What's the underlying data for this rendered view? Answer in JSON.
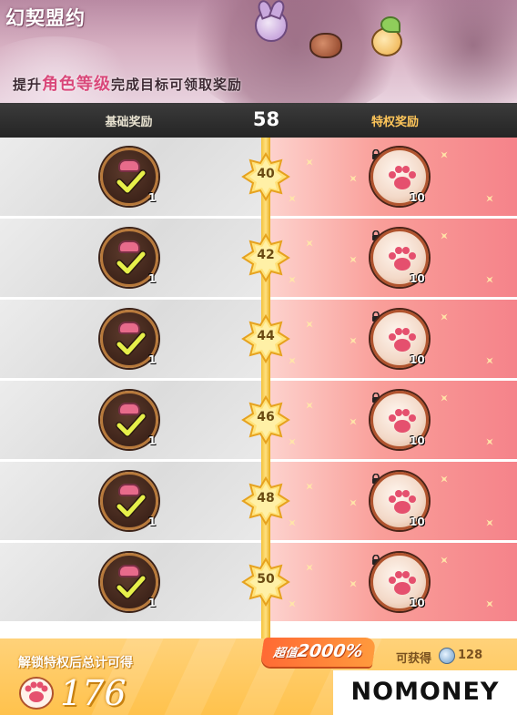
{
  "header": {
    "title": "幻契盟约",
    "subtitle_prefix": "提升",
    "subtitle_highlight": "角色等级",
    "subtitle_suffix": "完成目标可领取奖励"
  },
  "columns": {
    "basic_label": "基础奖励",
    "current_level": "58",
    "premium_label": "特权奖励"
  },
  "rows": [
    {
      "level": "40",
      "basic_qty": "1",
      "premium_qty": "10"
    },
    {
      "level": "42",
      "basic_qty": "1",
      "premium_qty": "10"
    },
    {
      "level": "44",
      "basic_qty": "1",
      "premium_qty": "10"
    },
    {
      "level": "46",
      "basic_qty": "1",
      "premium_qty": "10"
    },
    {
      "level": "48",
      "basic_qty": "1",
      "premium_qty": "10"
    },
    {
      "level": "50",
      "basic_qty": "1",
      "premium_qty": "10"
    }
  ],
  "bottom": {
    "unlock_label": "解锁特权后总计可得",
    "total": "176",
    "value_prefix": "超值",
    "value_percent": "2000%",
    "obtain_label": "可获得",
    "obtain_value": "128"
  },
  "watermark": {
    "logo_text": "NOMONEY"
  },
  "icons": {
    "basic_reward": "heart-claimed-check-icon",
    "premium_reward": "paw-icon",
    "lock": "lock-icon",
    "currency": "crystal-icon"
  },
  "colors": {
    "premium_bg": "#f5838a",
    "basic_bg": "#dcdcdc",
    "track": "#f4c23a",
    "accent": "#ff6a34"
  }
}
